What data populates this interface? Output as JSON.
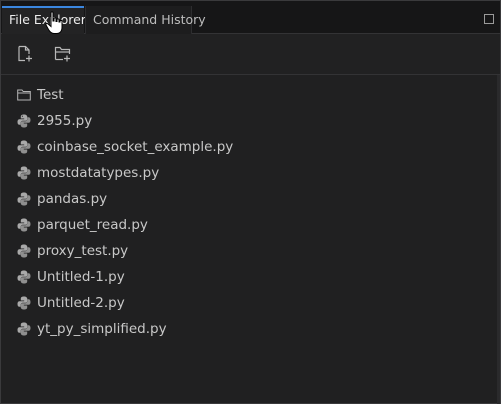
{
  "tabs": [
    {
      "label": "File Explorer",
      "active": true
    },
    {
      "label": "Command History",
      "active": false
    }
  ],
  "toolbar": {
    "new_file_icon": "new-file-icon",
    "new_folder_icon": "new-folder-icon"
  },
  "files": [
    {
      "name": "Test",
      "type": "folder"
    },
    {
      "name": "2955.py",
      "type": "python"
    },
    {
      "name": "coinbase_socket_example.py",
      "type": "python"
    },
    {
      "name": "mostdatatypes.py",
      "type": "python"
    },
    {
      "name": "pandas.py",
      "type": "python"
    },
    {
      "name": "parquet_read.py",
      "type": "python"
    },
    {
      "name": "proxy_test.py",
      "type": "python"
    },
    {
      "name": "Untitled-1.py",
      "type": "python"
    },
    {
      "name": "Untitled-2.py",
      "type": "python"
    },
    {
      "name": "yt_py_simplified.py",
      "type": "python"
    }
  ],
  "colors": {
    "accent": "#3b87e0",
    "background": "#202021"
  }
}
